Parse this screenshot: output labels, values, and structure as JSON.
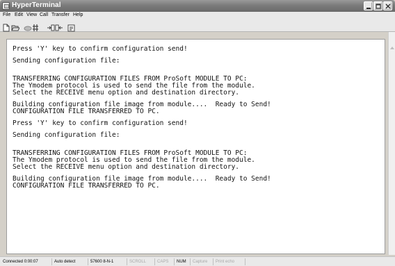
{
  "window": {
    "title": "HyperTerminal"
  },
  "menu": {
    "items": [
      {
        "label": "File"
      },
      {
        "label": "Edit"
      },
      {
        "label": "View"
      },
      {
        "label": "Call"
      },
      {
        "label": "Transfer"
      },
      {
        "label": "Help"
      }
    ]
  },
  "toolbar": {
    "icons": [
      "new-icon",
      "open-icon",
      "disconnect-icon",
      "call-icon",
      "send-icon",
      "properties-icon"
    ]
  },
  "terminal": {
    "lines": [
      "Press 'Y' key to confirm configuration send!",
      "Sending configuration file:",
      "TRANSFERRING CONFIGURATION FILES FROM ProSoft MODULE TO PC:",
      "The Ymodem protocol is used to send the file from the module.",
      "Select the RECEIVE menu option and destination directory.",
      "Building configuration file image from module....  Ready to Send!",
      "CONFIGURATION FILE TRANSFERRED TO PC.",
      "Press 'Y' key to confirm configuration send!",
      "Sending configuration file:",
      "TRANSFERRING CONFIGURATION FILES FROM ProSoft MODULE TO PC:",
      "The Ymodem protocol is used to send the file from the module.",
      "Select the RECEIVE menu option and destination directory.",
      "Building configuration file image from module....  Ready to Send!",
      "CONFIGURATION FILE TRANSFERRED TO PC."
    ]
  },
  "status": {
    "connected": "Connected 0:00:07",
    "detect": "Auto detect",
    "settings": "57600 8-N-1",
    "scroll": "SCROLL",
    "caps": "CAPS",
    "num": "NUM",
    "capture": "Capture",
    "print_echo": "Print echo"
  },
  "colors": {
    "titlebar": "#7b7b7b",
    "terminal_bg": "#ffffff",
    "terminal_text": "#111111",
    "chrome": "#e9e9e9"
  }
}
